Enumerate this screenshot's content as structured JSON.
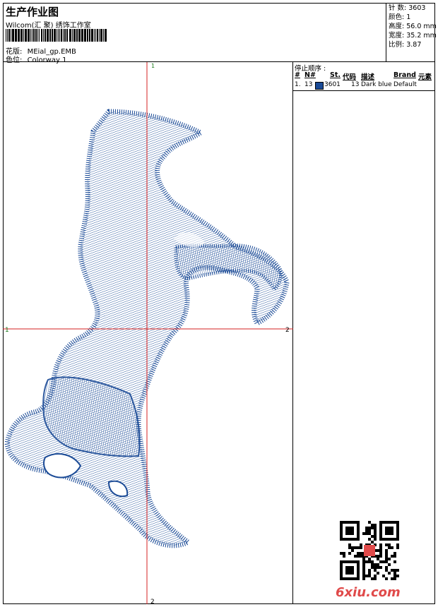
{
  "header": {
    "title": "生产作业图",
    "studio": "Wilcom(汇 聚) 绣饰工作室",
    "design_label": "花版:",
    "design_value": "MEial_gp.EMB",
    "colorway_label": "色位:",
    "colorway_value": "Colorway 1"
  },
  "stats": {
    "stitches": "针 数: 3603",
    "colors": "颜色: 1",
    "height": "高度: 56.0 mm",
    "width": "宽度: 35.2 mm",
    "scale": "比例: 3.87"
  },
  "crosshair": {
    "top": "1",
    "bottom": "2",
    "left": "1",
    "right": "2"
  },
  "stop_sequence": {
    "title": "停止顺序 :",
    "columns": [
      "#",
      "N#",
      "St.",
      "代码",
      "描述",
      "Brand",
      "元素"
    ],
    "rows": [
      {
        "index": "1.",
        "needle": "13",
        "code": "3601",
        "st": "13",
        "desc": "Dark blue",
        "brand": "Default",
        "color": "#1a4a96"
      }
    ]
  },
  "watermark": "6xiu.com",
  "colors": {
    "thread": "#1a4a96",
    "crosshair": "#d62020",
    "watermark": "#e04a4a"
  }
}
